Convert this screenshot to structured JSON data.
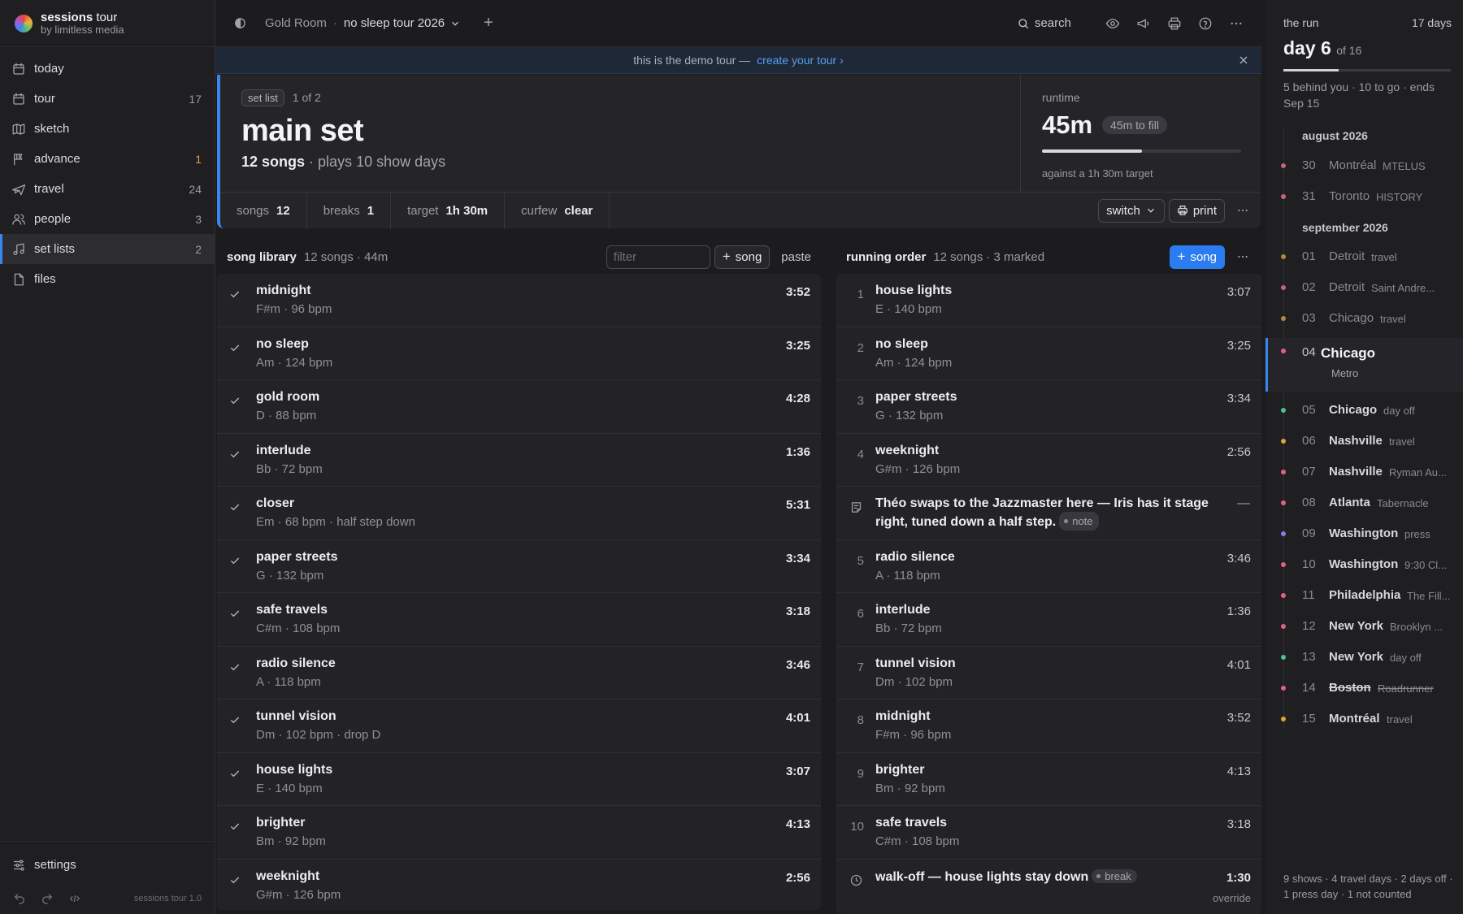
{
  "brand": {
    "name_bold": "sessions",
    "name_rest": " tour",
    "sub": "by limitless media"
  },
  "sidebar": {
    "items": [
      {
        "label": "today",
        "count": "",
        "icon": "calendar-icon"
      },
      {
        "label": "tour",
        "count": "17",
        "icon": "calendar-icon"
      },
      {
        "label": "sketch",
        "count": "",
        "icon": "map-icon"
      },
      {
        "label": "advance",
        "count": "1",
        "icon": "flag-icon"
      },
      {
        "label": "travel",
        "count": "24",
        "icon": "plane-icon"
      },
      {
        "label": "people",
        "count": "3",
        "icon": "people-icon"
      },
      {
        "label": "set lists",
        "count": "2",
        "icon": "music-note-icon"
      },
      {
        "label": "files",
        "count": "",
        "icon": "file-icon"
      }
    ],
    "active_index": 6,
    "settings_label": "settings",
    "version": "sessions tour 1.0"
  },
  "topbar": {
    "venue": "Gold Room",
    "sep": "·",
    "tour": "no sleep tour 2026",
    "add_label": "+",
    "search_label": "search"
  },
  "banner": {
    "text": "this is the demo tour —",
    "link": "create your tour ›"
  },
  "hero": {
    "tag": "set list",
    "position": "1 of 2",
    "title": "main set",
    "songs_bold": "12 songs",
    "plays": "· plays 10 show days",
    "runtime_label": "runtime",
    "runtime_value": "45m",
    "fill_pill": "45m to fill",
    "runtime_progress": 0.5,
    "runtime_note": "against a 1h 30m target"
  },
  "stats": [
    {
      "label": "songs",
      "value": "12"
    },
    {
      "label": "breaks",
      "value": "1"
    },
    {
      "label": "target",
      "value": "1h 30m"
    },
    {
      "label": "curfew",
      "value": "clear"
    }
  ],
  "actions": {
    "switch": "switch",
    "print": "print"
  },
  "library": {
    "title": "song library",
    "meta": "12 songs · 44m",
    "filter_placeholder": "filter",
    "add_label": "song",
    "paste_label": "paste",
    "songs": [
      {
        "name": "midnight",
        "meta": "F#m · 96 bpm",
        "dur": "3:52"
      },
      {
        "name": "no sleep",
        "meta": "Am · 124 bpm",
        "dur": "3:25"
      },
      {
        "name": "gold room",
        "meta": "D · 88 bpm",
        "dur": "4:28"
      },
      {
        "name": "interlude",
        "meta": "Bb · 72 bpm",
        "dur": "1:36"
      },
      {
        "name": "closer",
        "meta": "Em · 68 bpm · half step down",
        "dur": "5:31"
      },
      {
        "name": "paper streets",
        "meta": "G · 132 bpm",
        "dur": "3:34"
      },
      {
        "name": "safe travels",
        "meta": "C#m · 108 bpm",
        "dur": "3:18"
      },
      {
        "name": "radio silence",
        "meta": "A · 118 bpm",
        "dur": "3:46"
      },
      {
        "name": "tunnel vision",
        "meta": "Dm · 102 bpm · drop D",
        "dur": "4:01"
      },
      {
        "name": "house lights",
        "meta": "E · 140 bpm",
        "dur": "3:07"
      },
      {
        "name": "brighter",
        "meta": "Bm · 92 bpm",
        "dur": "4:13"
      },
      {
        "name": "weeknight",
        "meta": "G#m · 126 bpm",
        "dur": "2:56"
      }
    ]
  },
  "running": {
    "title": "running order",
    "meta": "12 songs · 3 marked",
    "add_label": "song",
    "rows": [
      {
        "kind": "song",
        "num": "1",
        "name": "house lights",
        "meta": "E · 140 bpm",
        "dur": "3:07"
      },
      {
        "kind": "song",
        "num": "2",
        "name": "no sleep",
        "meta": "Am · 124 bpm",
        "dur": "3:25"
      },
      {
        "kind": "song",
        "num": "3",
        "name": "paper streets",
        "meta": "G · 132 bpm",
        "dur": "3:34"
      },
      {
        "kind": "song",
        "num": "4",
        "name": "weeknight",
        "meta": "G#m · 126 bpm",
        "dur": "2:56"
      },
      {
        "kind": "note",
        "name": "Théo swaps to the Jazzmaster here — Iris has it stage right, tuned down a half step.",
        "chip": "note",
        "dur": "—"
      },
      {
        "kind": "song",
        "num": "5",
        "name": "radio silence",
        "meta": "A · 118 bpm",
        "dur": "3:46"
      },
      {
        "kind": "song",
        "num": "6",
        "name": "interlude",
        "meta": "Bb · 72 bpm",
        "dur": "1:36"
      },
      {
        "kind": "song",
        "num": "7",
        "name": "tunnel vision",
        "meta": "Dm · 102 bpm",
        "dur": "4:01"
      },
      {
        "kind": "song",
        "num": "8",
        "name": "midnight",
        "meta": "F#m · 96 bpm",
        "dur": "3:52"
      },
      {
        "kind": "song",
        "num": "9",
        "name": "brighter",
        "meta": "Bm · 92 bpm",
        "dur": "4:13"
      },
      {
        "kind": "song",
        "num": "10",
        "name": "safe travels",
        "meta": "C#m · 108 bpm",
        "dur": "3:18"
      },
      {
        "kind": "break",
        "name": "walk-off — house lights stay down",
        "chip": "break",
        "dur": "1:30",
        "sub": "override"
      }
    ]
  },
  "run": {
    "label": "the run",
    "days": "17 days",
    "day": "day 6",
    "of": "of 16",
    "progress": 0.33,
    "info": "5 behind you · 10 to go · ends Sep 15",
    "months": [
      "august 2026",
      "september 2026"
    ],
    "days_list": [
      {
        "n": "30",
        "city": "Montréal",
        "venue": "MTELUS",
        "color": "#c9637a",
        "muted": true
      },
      {
        "n": "31",
        "city": "Toronto",
        "venue": "HISTORY",
        "color": "#c9637a",
        "muted": true
      },
      {
        "n": "01",
        "city": "Detroit",
        "venue": "travel",
        "color": "#b08846",
        "muted": true
      },
      {
        "n": "02",
        "city": "Detroit",
        "venue": "Saint Andre...",
        "color": "#c9637a",
        "muted": true
      },
      {
        "n": "03",
        "city": "Chicago",
        "venue": "travel",
        "color": "#b08846",
        "muted": true
      },
      {
        "n": "04",
        "city": "Chicago",
        "venue": "Metro",
        "color": "#e0627e",
        "current": true
      },
      {
        "n": "05",
        "city": "Chicago",
        "venue": "day off",
        "color": "#4bc28c"
      },
      {
        "n": "06",
        "city": "Nashville",
        "venue": "travel",
        "color": "#e0a33c"
      },
      {
        "n": "07",
        "city": "Nashville",
        "venue": "Ryman Au...",
        "color": "#e0627e"
      },
      {
        "n": "08",
        "city": "Atlanta",
        "venue": "Tabernacle",
        "color": "#e0627e"
      },
      {
        "n": "09",
        "city": "Washington",
        "venue": "press",
        "color": "#8a7cf0"
      },
      {
        "n": "10",
        "city": "Washington",
        "venue": "9:30 Cl...",
        "color": "#e0627e"
      },
      {
        "n": "11",
        "city": "Philadelphia",
        "venue": "The Fill...",
        "color": "#e0627e"
      },
      {
        "n": "12",
        "city": "New York",
        "venue": "Brooklyn ...",
        "color": "#e0627e"
      },
      {
        "n": "13",
        "city": "New York",
        "venue": "day off",
        "color": "#4bc28c"
      },
      {
        "n": "14",
        "city": "Boston",
        "venue": "Roadrunner",
        "color": "#e0627e",
        "strike": true
      },
      {
        "n": "15",
        "city": "Montréal",
        "venue": "travel",
        "color": "#e0a33c"
      }
    ],
    "footer": "9 shows · 4 travel days · 2 days off · 1 press day · 1 not counted"
  }
}
